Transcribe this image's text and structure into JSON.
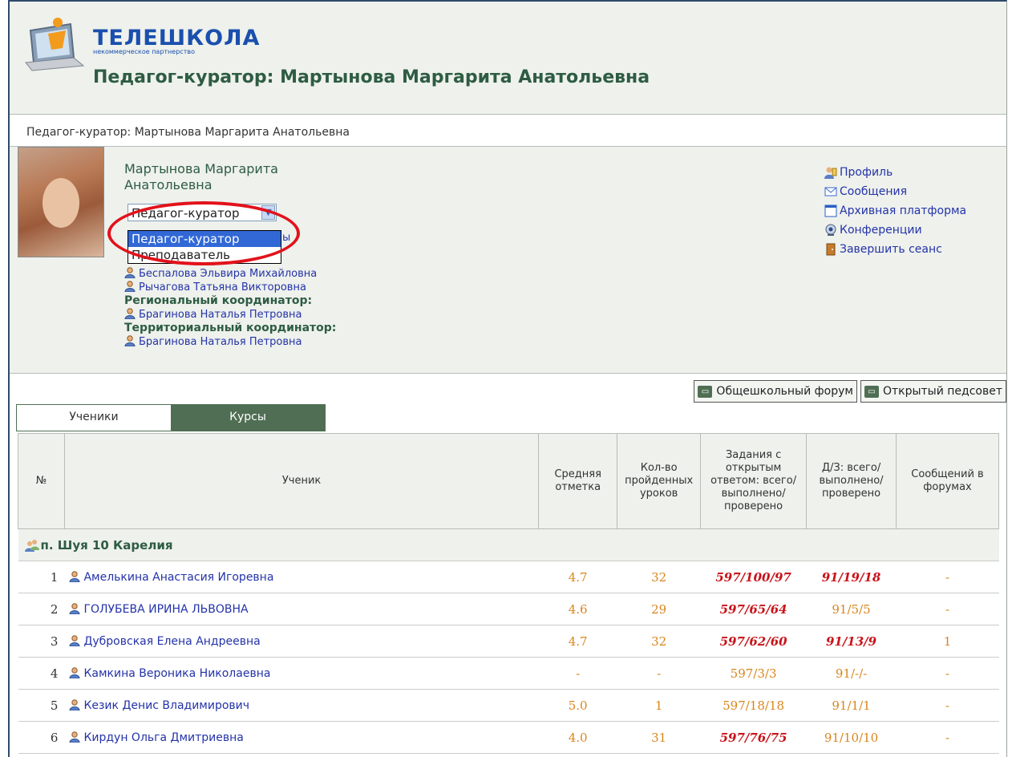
{
  "header": {
    "logo_text": "ТЕЛЕШКОЛА",
    "logo_sub": "некоммерческое партнерство",
    "title": "Педагог-куратор: Мартынова Маргарита Анатольевна"
  },
  "breadcrumb": "Педагог-куратор: Мартынова Маргарита Анатольевна",
  "profile": {
    "name": "Мартынова Маргарита Анатольевна",
    "role_select": {
      "selected": "Педагог-куратор",
      "options": [
        "Педагог-куратор",
        "Преподаватель"
      ]
    },
    "partial_hidden_tail": "ы",
    "people": [
      {
        "type": "person",
        "name": "Беспалова Эльвира Михайловна"
      },
      {
        "type": "person",
        "name": "Рычагова Татьяна Викторовна"
      },
      {
        "type": "role",
        "name": "Региональный координатор:"
      },
      {
        "type": "person",
        "name": "Брагинова Наталья Петровна"
      },
      {
        "type": "role",
        "name": "Территориальный координатор:"
      },
      {
        "type": "person",
        "name": "Брагинова Наталья Петровна"
      }
    ],
    "links": [
      {
        "label": "Профиль",
        "icon": "profile-icon"
      },
      {
        "label": "Сообщения",
        "icon": "mail-icon"
      },
      {
        "label": "Архивная платформа",
        "icon": "window-icon"
      },
      {
        "label": "Конференции",
        "icon": "webcam-icon"
      },
      {
        "label": "Завершить сеанс",
        "icon": "door-icon"
      }
    ]
  },
  "forum_buttons": [
    "Общешкольный форум",
    "Открытый педсовет"
  ],
  "tabs": [
    "Ученики",
    "Курсы"
  ],
  "table": {
    "headers": [
      "№",
      "Ученик",
      "Средняя отметка",
      "Кол-во пройденных уроков",
      "Задания с открытым ответом: всего/ выполнено/ проверено",
      "Д/З: всего/ выполнено/ проверено",
      "Сообщений в форумах"
    ],
    "group": "п. Шуя 10 Карелия",
    "rows": [
      {
        "n": "1",
        "name": "Амелькина Анастасия Игоревна",
        "avg": "4.7",
        "lessons": "32",
        "tasks": "597/100/97",
        "tasks_red": true,
        "hw": "91/19/18",
        "hw_red": true,
        "msgs": "-"
      },
      {
        "n": "2",
        "name": "ГОЛУБЕВА ИРИНА ЛЬВОВНА",
        "avg": "4.6",
        "lessons": "29",
        "tasks": "597/65/64",
        "tasks_red": true,
        "hw": "91/5/5",
        "hw_red": false,
        "msgs": "-"
      },
      {
        "n": "3",
        "name": "Дубровская Елена Андреевна",
        "avg": "4.7",
        "lessons": "32",
        "tasks": "597/62/60",
        "tasks_red": true,
        "hw": "91/13/9",
        "hw_red": true,
        "msgs": "1"
      },
      {
        "n": "4",
        "name": "Камкина Вероника Николаевна",
        "avg": "-",
        "lessons": "-",
        "tasks": "597/3/3",
        "tasks_red": false,
        "hw": "91/-/-",
        "hw_red": false,
        "msgs": "-"
      },
      {
        "n": "5",
        "name": "Кезик Денис Владимирович",
        "avg": "5.0",
        "lessons": "1",
        "tasks": "597/18/18",
        "tasks_red": false,
        "hw": "91/1/1",
        "hw_red": false,
        "msgs": "-"
      },
      {
        "n": "6",
        "name": "Кирдун Ольга Дмитриевна",
        "avg": "4.0",
        "lessons": "31",
        "tasks": "597/76/75",
        "tasks_red": true,
        "hw": "91/10/10",
        "hw_red": false,
        "msgs": "-"
      }
    ]
  },
  "colors": {
    "accent_green": "#4f6e53",
    "link_blue": "#2433a8",
    "orange": "#d9861c",
    "red": "#c8131a",
    "highlight_ellipse": "#e2121b"
  }
}
